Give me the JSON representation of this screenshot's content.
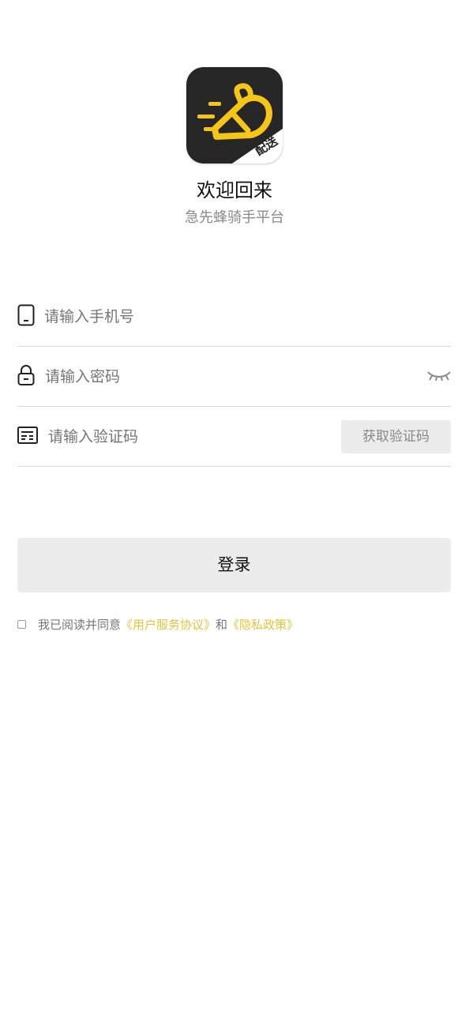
{
  "logo": {
    "badge_text": "配送",
    "colors": {
      "background": "#262626",
      "bee": "#f5c518",
      "badge": "#ffffff"
    }
  },
  "header": {
    "title": "欢迎回来",
    "subtitle": "急先蜂骑手平台"
  },
  "form": {
    "phone_placeholder": "请输入手机号",
    "password_placeholder": "请输入密码",
    "code_placeholder": "请输入验证码",
    "get_code_label": "获取验证码"
  },
  "login_label": "登录",
  "agreement": {
    "prefix": "我已阅读并同意",
    "terms_link": "《用户服务协议》",
    "conjunction": "和",
    "privacy_link": "《隐私政策》",
    "link_color": "#e6c43a"
  },
  "icons": {
    "phone": "phone-icon",
    "lock": "lock-icon",
    "code": "verification-code-icon",
    "eye": "eye-closed-icon"
  }
}
